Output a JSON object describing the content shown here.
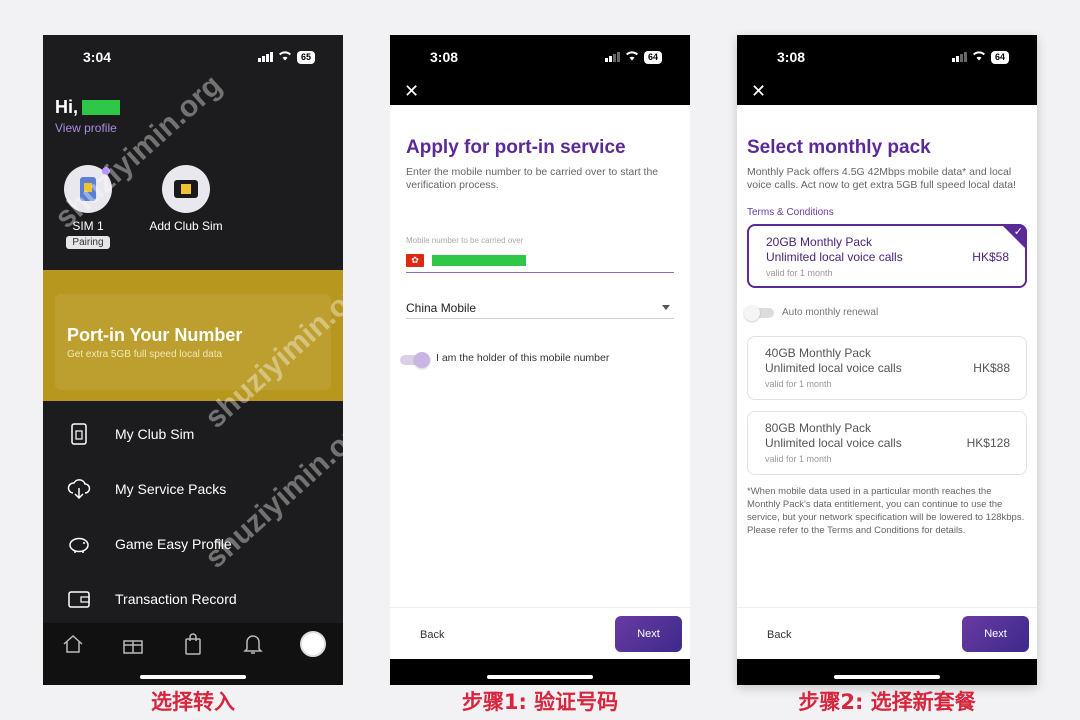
{
  "screen1": {
    "time": "3:04",
    "battery": "65",
    "greeting": "Hi,",
    "view_profile": "View profile",
    "sims": [
      {
        "label": "SIM 1",
        "badge": "Pairing"
      },
      {
        "label": "Add Club Sim"
      }
    ],
    "banner_title": "Port-in Your Number",
    "banner_subtitle": "Get extra 5GB full speed local data",
    "menu": [
      {
        "label": "My Club Sim",
        "icon": "sim-card-icon"
      },
      {
        "label": "My Service Packs",
        "icon": "cloud-download-icon"
      },
      {
        "label": "Game Easy Profile",
        "icon": "piggy-bank-icon"
      },
      {
        "label": "Transaction Record",
        "icon": "wallet-icon"
      }
    ],
    "tabs": [
      "home-icon",
      "gift-icon",
      "shopping-bag-icon",
      "bell-icon",
      "profile-avatar"
    ],
    "watermark": "shuziyimin.org",
    "caption": "选择转入"
  },
  "screen2": {
    "time": "3:08",
    "battery": "64",
    "title": "Apply for port-in service",
    "description": "Enter the mobile number to be carried over to start the verification process.",
    "field_label": "Mobile number to be carried over",
    "carrier": "China Mobile",
    "holder_text": "I am the holder of this mobile number",
    "back": "Back",
    "next": "Next",
    "caption": "步骤1: 验证号码"
  },
  "screen3": {
    "time": "3:08",
    "battery": "64",
    "title": "Select monthly pack",
    "description": "Monthly Pack offers 4.5G 42Mbps mobile data* and local voice calls. Act now to get extra 5GB full speed local data!",
    "terms": "Terms & Conditions",
    "packs": [
      {
        "name": "20GB Monthly Pack",
        "calls": "Unlimited local voice calls",
        "price": "HK$58",
        "valid": "valid for  1 month",
        "selected": true
      },
      {
        "name": "40GB Monthly Pack",
        "calls": "Unlimited local voice calls",
        "price": "HK$88",
        "valid": "valid for  1 month",
        "selected": false
      },
      {
        "name": "80GB Monthly Pack",
        "calls": "Unlimited local voice calls",
        "price": "HK$128",
        "valid": "valid for  1 month",
        "selected": false
      }
    ],
    "auto_renewal": "Auto monthly renewal",
    "note": "*When mobile data used in a particular month reaches the Monthly Pack's data entitlement, you can continue to use the service, but your network specification will be lowered to 128kbps. Please refer to the Terms and Conditions for details.",
    "back": "Back",
    "next": "Next",
    "caption": "步骤2: 选择新套餐"
  },
  "colors": {
    "accent_purple": "#5b2a96",
    "banner_gold": "#b8971f",
    "caption_red": "#d7263d",
    "redacted_green": "#2ec748"
  }
}
